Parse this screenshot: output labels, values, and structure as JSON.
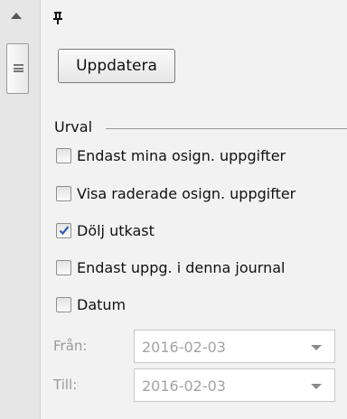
{
  "toolbar": {
    "refresh_label": "Uppdatera"
  },
  "filter": {
    "group_title": "Urval",
    "options": [
      {
        "label": "Endast mina osign. uppgifter",
        "checked": false
      },
      {
        "label": "Visa raderade osign. uppgifter",
        "checked": false
      },
      {
        "label": "Dölj utkast",
        "checked": true
      },
      {
        "label": "Endast uppg. i denna journal",
        "checked": false
      },
      {
        "label": "Datum",
        "checked": false
      }
    ],
    "from": {
      "label": "Från:",
      "value": "2016-02-03"
    },
    "to": {
      "label": "Till:",
      "value": "2016-02-03"
    }
  },
  "icons": {
    "pin": "pin-icon",
    "scroll_up": "scroll-up-arrow-icon",
    "dropdown": "chevron-down-icon",
    "check": "checkmark-icon"
  },
  "colors": {
    "check_accent": "#2b5fb4",
    "disabled_text": "#9a9a9a"
  }
}
